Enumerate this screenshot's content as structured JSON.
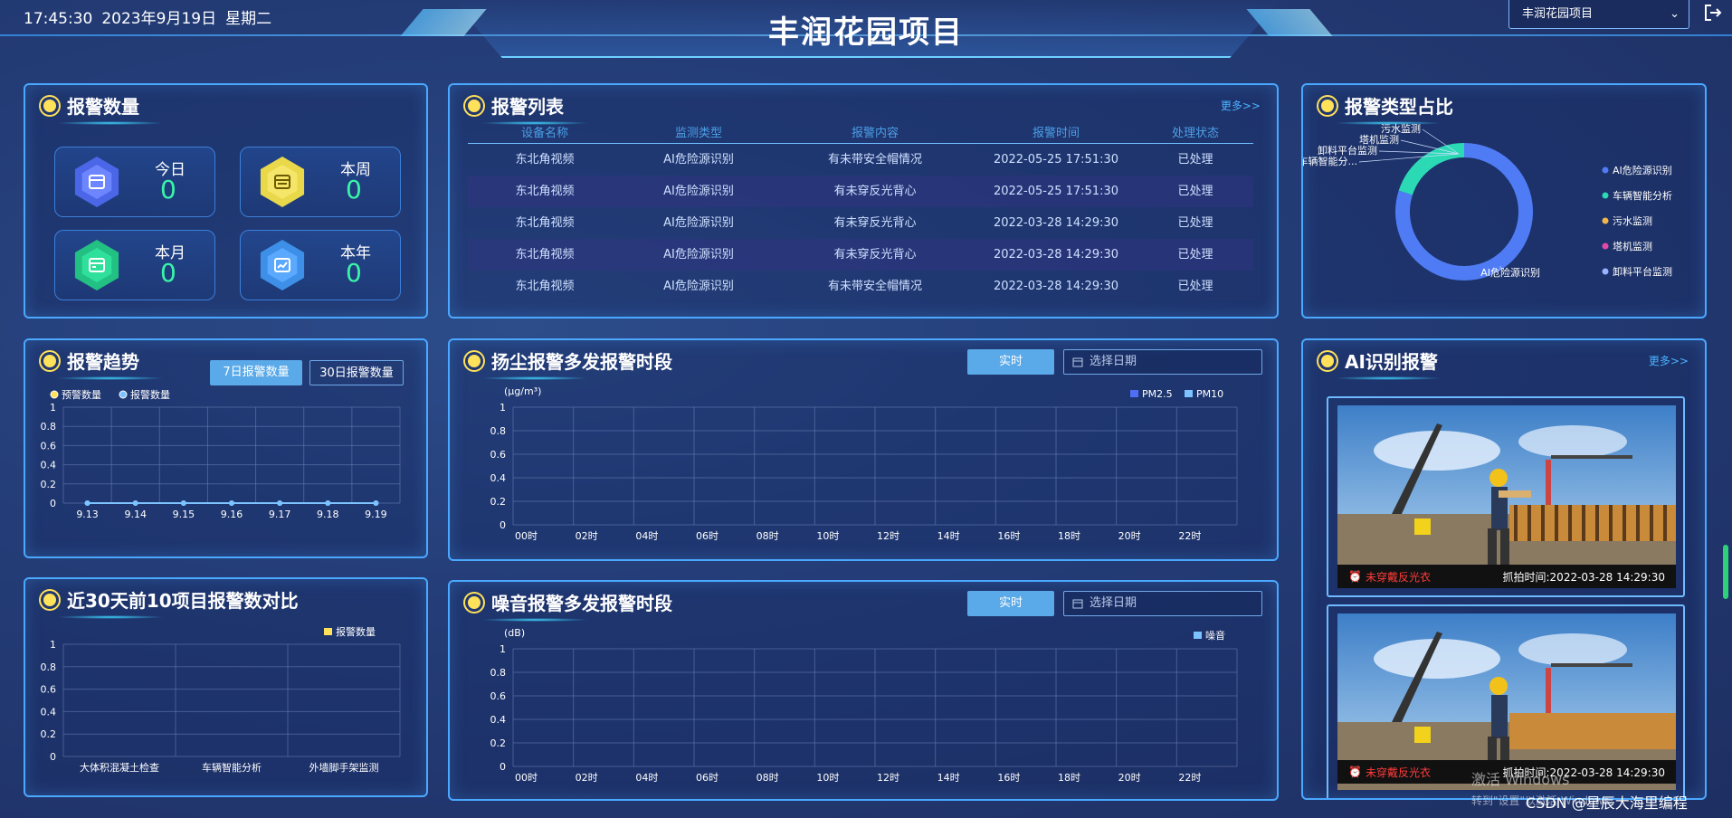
{
  "header": {
    "time": "17:45:30",
    "date": "2023年9月19日",
    "weekday": "星期二",
    "title": "丰润花园项目",
    "project_select": "丰润花园项目"
  },
  "alarm_count": {
    "title": "报警数量",
    "stats": [
      {
        "label": "今日",
        "value": "0"
      },
      {
        "label": "本周",
        "value": "0"
      },
      {
        "label": "本月",
        "value": "0"
      },
      {
        "label": "本年",
        "value": "0"
      }
    ]
  },
  "alarm_list": {
    "title": "报警列表",
    "more": "更多>>",
    "columns": [
      "设备名称",
      "监测类型",
      "报警内容",
      "报警时间",
      "处理状态"
    ],
    "rows": [
      [
        "东北角视频",
        "AI危险源识别",
        "有未带安全帽情况",
        "2022-05-25 17:51:30",
        "已处理"
      ],
      [
        "东北角视频",
        "AI危险源识别",
        "有未穿反光背心",
        "2022-05-25 17:51:30",
        "已处理"
      ],
      [
        "东北角视频",
        "AI危险源识别",
        "有未穿反光背心",
        "2022-03-28 14:29:30",
        "已处理"
      ],
      [
        "东北角视频",
        "AI危险源识别",
        "有未穿反光背心",
        "2022-03-28 14:29:30",
        "已处理"
      ],
      [
        "东北角视频",
        "AI危险源识别",
        "有未带安全帽情况",
        "2022-03-28 14:29:30",
        "已处理"
      ]
    ]
  },
  "alarm_type": {
    "title": "报警类型占比",
    "legend": [
      "AI危险源识别",
      "车辆智能分析",
      "污水监测",
      "塔机监测",
      "卸料平台监测"
    ],
    "legend_colors": [
      "#4f7cf5",
      "#2bd9b5",
      "#f2b64a",
      "#e24aa8",
      "#9ab2ff"
    ],
    "callouts": [
      "污水监测",
      "塔机监测",
      "卸料平台监测",
      "车辆智能分...",
      "AI危险源识别"
    ]
  },
  "alarm_trend": {
    "title": "报警趋势",
    "btn_7": "7日报警数量",
    "btn_30": "30日报警数量"
  },
  "dust": {
    "title": "扬尘报警多发报警时段",
    "btn_realtime": "实时",
    "date_placeholder": "选择日期"
  },
  "top10": {
    "title": "近30天前10项目报警数对比"
  },
  "noise": {
    "title": "噪音报警多发报警时段",
    "btn_realtime": "实时",
    "date_placeholder": "选择日期"
  },
  "ai": {
    "title": "AI识别报警",
    "more": "更多>>",
    "cards": [
      {
        "alert": "未穿戴反光衣",
        "time": "抓拍时间:2022-03-28 14:29:30"
      },
      {
        "alert": "未穿戴反光衣",
        "time": "抓拍时间:2022-03-28 14:29:30"
      }
    ]
  },
  "watermark": {
    "line1": "激活 Windows",
    "line2": "转到\"设置\"以激活 Windows。",
    "csdn": "CSDN @星辰大海里编程"
  },
  "chart_data": [
    {
      "type": "line",
      "title": "报警趋势",
      "categories": [
        "9.13",
        "9.14",
        "9.15",
        "9.16",
        "9.17",
        "9.18",
        "9.19"
      ],
      "series": [
        {
          "name": "预警数量",
          "values": [
            0,
            0,
            0,
            0,
            0,
            0,
            0
          ]
        },
        {
          "name": "报警数量",
          "values": [
            0,
            0,
            0,
            0,
            0,
            0,
            0
          ]
        }
      ],
      "ylim": [
        0,
        1
      ],
      "yticks": [
        "0",
        "0.2",
        "0.4",
        "0.6",
        "0.8",
        "1"
      ],
      "legend": "top-left",
      "grid": true
    },
    {
      "type": "bar",
      "title": "扬尘报警多发报警时段",
      "ylabel": "(μg/m³)",
      "categories": [
        "00时",
        "02时",
        "04时",
        "06时",
        "08时",
        "10时",
        "12时",
        "14时",
        "16时",
        "18时",
        "20时",
        "22时"
      ],
      "series": [
        {
          "name": "PM2.5",
          "values": []
        },
        {
          "name": "PM10",
          "values": []
        }
      ],
      "ylim": [
        0,
        1
      ],
      "yticks": [
        "0",
        "0.2",
        "0.4",
        "0.6",
        "0.8",
        "1"
      ],
      "legend": "top-right",
      "grid": true
    },
    {
      "type": "bar",
      "title": "近30天前10项目报警数对比",
      "categories": [
        "大体积混凝土检查",
        "车辆智能分析",
        "外墙脚手架监测"
      ],
      "series": [
        {
          "name": "报警数量",
          "values": []
        }
      ],
      "ylim": [
        0,
        1
      ],
      "yticks": [
        "0",
        "0.2",
        "0.4",
        "0.6",
        "0.8",
        "1"
      ],
      "legend": "top-right",
      "grid": true
    },
    {
      "type": "bar",
      "title": "噪音报警多发报警时段",
      "ylabel": "(dB)",
      "categories": [
        "00时",
        "02时",
        "04时",
        "06时",
        "08时",
        "10时",
        "12时",
        "14时",
        "16时",
        "18时",
        "20时",
        "22时"
      ],
      "series": [
        {
          "name": "噪音",
          "values": []
        }
      ],
      "ylim": [
        0,
        1
      ],
      "yticks": [
        "0",
        "0.2",
        "0.4",
        "0.6",
        "0.8",
        "1"
      ],
      "legend": "top-right",
      "grid": true
    },
    {
      "type": "pie",
      "title": "报警类型占比",
      "categories": [
        "AI危险源识别",
        "车辆智能分析",
        "污水监测",
        "塔机监测",
        "卸料平台监测"
      ],
      "values": [
        80,
        20,
        0,
        0,
        0
      ],
      "legend": "right"
    }
  ]
}
